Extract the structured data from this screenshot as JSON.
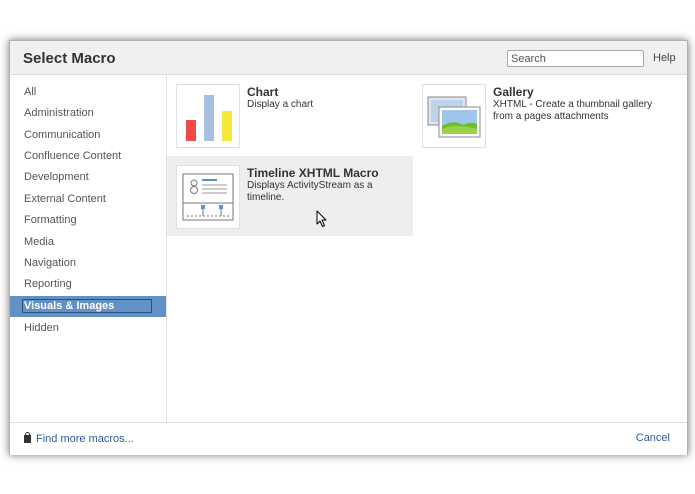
{
  "dialog": {
    "title": "Select Macro",
    "search_placeholder": "Search",
    "help_label": "Help"
  },
  "sidebar": {
    "selected_index": 10,
    "items": [
      {
        "label": "All"
      },
      {
        "label": "Administration"
      },
      {
        "label": "Communication"
      },
      {
        "label": "Confluence Content"
      },
      {
        "label": "Development"
      },
      {
        "label": "External Content"
      },
      {
        "label": "Formatting"
      },
      {
        "label": "Media"
      },
      {
        "label": "Navigation"
      },
      {
        "label": "Reporting"
      },
      {
        "label": "Visuals & Images"
      },
      {
        "label": "Hidden"
      }
    ]
  },
  "macros": [
    {
      "title": "Chart",
      "description": "Display a chart",
      "icon": "bar-chart-icon"
    },
    {
      "title": "Gallery",
      "description": "XHTML - Create a thumbnail gallery from a pages attachments",
      "icon": "gallery-icon"
    },
    {
      "title": "Timeline XHTML Macro",
      "description": "Displays ActivityStream as a timeline.",
      "icon": "timeline-icon",
      "hovered": true
    }
  ],
  "footer": {
    "find_more_label": "Find more macros...",
    "cancel_label": "Cancel"
  },
  "colors": {
    "selected_bg": "#6191c5",
    "link": "#2f5b9a",
    "bar_red": "#f04a4a",
    "bar_blue": "#a8c0e0",
    "bar_yellow": "#f5e83a"
  }
}
